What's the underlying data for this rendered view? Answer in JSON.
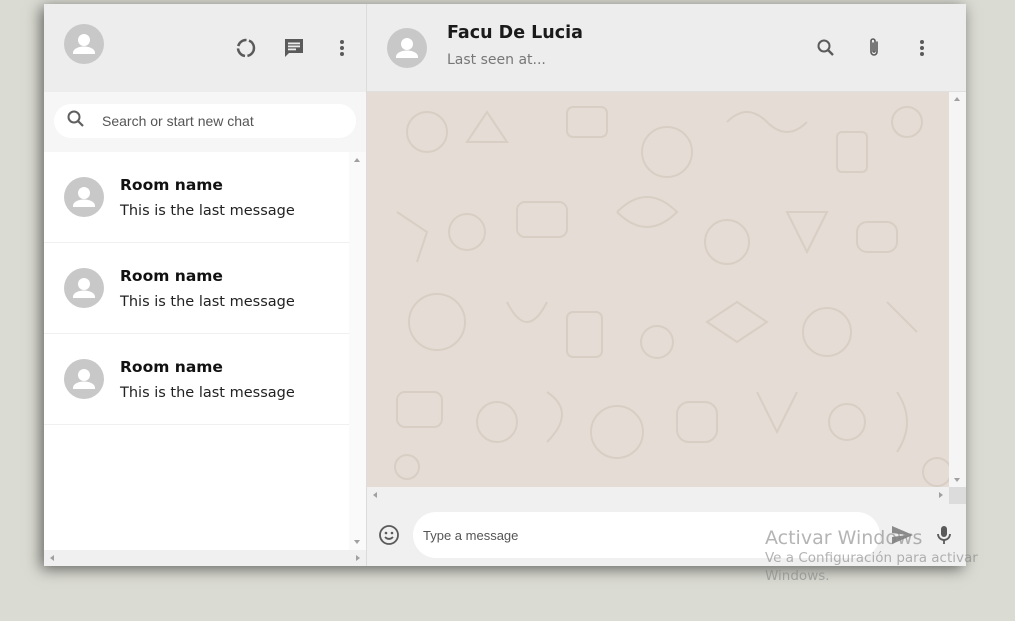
{
  "sidebar": {
    "search_placeholder": "Search or start new chat",
    "chats": [
      {
        "name": "Room name",
        "last_message": "This is the last message"
      },
      {
        "name": "Room name",
        "last_message": "This is the last message"
      },
      {
        "name": "Room name",
        "last_message": "This is the last message"
      }
    ],
    "header_icons": [
      "status-icon",
      "chat-icon",
      "more-vert-icon"
    ]
  },
  "chat": {
    "contact_name": "Facu De Lucia",
    "last_seen": "Last seen at...",
    "header_icons": [
      "search-icon",
      "attach-icon",
      "more-vert-icon"
    ],
    "message_placeholder": "Type a message"
  },
  "watermark": {
    "title": "Activar Windows",
    "subtitle": "Ve a Configuración para activar Windows."
  },
  "colors": {
    "background": "#dadbd3",
    "header": "#ededed",
    "chat_background": "#e5ddd5",
    "avatar": "#c8c8c8",
    "icon": "#919191"
  }
}
